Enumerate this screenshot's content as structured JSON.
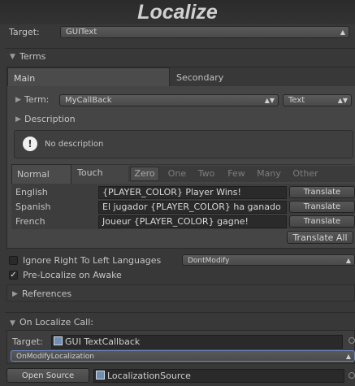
{
  "header": {
    "title": "Localize"
  },
  "target": {
    "label": "Target:",
    "value": "GUIText"
  },
  "terms": {
    "label": "Terms",
    "tabs": [
      "Main",
      "Secondary"
    ],
    "term_label": "Term:",
    "term_value": "MyCallBack",
    "term_type": "Text",
    "description_label": "Description",
    "no_description": "No description"
  },
  "modes": [
    "Normal",
    "Touch"
  ],
  "plural_forms": [
    "Zero",
    "One",
    "Two",
    "Few",
    "Many",
    "Other"
  ],
  "languages": [
    {
      "name": "English",
      "value": "{PLAYER_COLOR} Player Wins!",
      "button": "Translate"
    },
    {
      "name": "Spanish",
      "value": "El jugador {PLAYER_COLOR} ha ganado",
      "button": "Translate"
    },
    {
      "name": "French",
      "value": "Joueur {PLAYER_COLOR} gagne!",
      "button": "Translate"
    }
  ],
  "translate_all": "Translate All",
  "options": {
    "ignore_rtl_label": "Ignore Right To Left Languages",
    "ignore_rtl_checked": false,
    "rtl_mode": "DontModify",
    "pre_localize_label": "Pre-Localize on Awake",
    "pre_localize_checked": true
  },
  "references": {
    "label": "References"
  },
  "on_localize": {
    "label": "On Localize Call:",
    "target_label": "Target:",
    "target_value": "GUI TextCallback",
    "method": "OnModifyLocalization"
  },
  "footer": {
    "open_source": "Open Source",
    "source_value": "LocalizationSource"
  },
  "colors": {
    "background": "#383838",
    "panel": "#3c3c3c",
    "accent_border": "#6f86c6"
  }
}
